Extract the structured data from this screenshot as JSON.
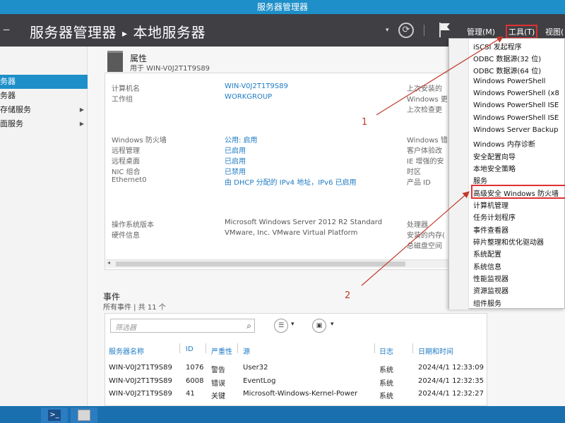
{
  "window": {
    "title": "服务器管理器"
  },
  "header": {
    "breadcrumb_root": "服务器管理器",
    "breadcrumb_sep": "▸",
    "breadcrumb_page": "本地服务器",
    "menu_manage": "管理(M)",
    "menu_tools": "工具(T)",
    "menu_view": "视图("
  },
  "sidebar": {
    "items": [
      {
        "label": "务器",
        "active": true
      },
      {
        "label": "务器",
        "active": false
      },
      {
        "label": "存储服务",
        "active": false
      },
      {
        "label": "面服务",
        "active": false
      }
    ]
  },
  "properties": {
    "title": "属性",
    "subtitle": "用于 WIN-V0J2T1T9S89",
    "rows_left": [
      {
        "label": "计算机名",
        "value": "WIN-V0J2T1T9S89"
      },
      {
        "label": "工作组",
        "value": "WORKGROUP"
      },
      {
        "label": "Windows 防火墙",
        "value": "公用: 启用"
      },
      {
        "label": "远程管理",
        "value": "已启用"
      },
      {
        "label": "远程桌面",
        "value": "已启用"
      },
      {
        "label": "NIC 组合",
        "value": "已禁用"
      },
      {
        "label": "Ethernet0",
        "value": "由 DHCP 分配的 IPv4 地址，IPv6 已启用"
      },
      {
        "label": "操作系统版本",
        "value": "Microsoft Windows Server 2012 R2 Standard"
      },
      {
        "label": "硬件信息",
        "value": "VMware, Inc. VMware Virtual Platform"
      }
    ],
    "rows_right": [
      "上次安装的",
      "Windows 更",
      "上次检查更",
      "Windows 错",
      "客户体验改",
      "IE 增强的安",
      "时区",
      "产品 ID",
      "处理器",
      "安装的内存(",
      "总磁盘空间"
    ]
  },
  "events": {
    "title": "事件",
    "subtitle": "所有事件 | 共 11 个",
    "filter_placeholder": "筛选器",
    "columns": [
      "服务器名称",
      "ID",
      "严重性",
      "源",
      "日志",
      "日期和时间"
    ],
    "rows": [
      [
        "WIN-V0J2T1T9S89",
        "1076",
        "警告",
        "User32",
        "系统",
        "2024/4/1 12:33:09"
      ],
      [
        "WIN-V0J2T1T9S89",
        "6008",
        "错误",
        "EventLog",
        "系统",
        "2024/4/1 12:32:35"
      ],
      [
        "WIN-V0J2T1T9S89",
        "41",
        "关键",
        "Microsoft-Windows-Kernel-Power",
        "系统",
        "2024/4/1 12:32:27"
      ]
    ]
  },
  "tools_menu": {
    "items": [
      "iSCSI 发起程序",
      "ODBC 数据源(32 位)",
      "ODBC 数据源(64 位)",
      "Windows PowerShell",
      "Windows PowerShell (x8",
      "Windows PowerShell ISE",
      "Windows PowerShell ISE",
      "Windows Server Backup",
      "Windows 内存诊断",
      "安全配置向导",
      "本地安全策略",
      "服务",
      "高级安全 Windows 防火墙",
      "计算机管理",
      "任务计划程序",
      "事件查看器",
      "碎片整理和优化驱动器",
      "系统配置",
      "系统信息",
      "性能监视器",
      "资源监视器",
      "组件服务"
    ],
    "highlighted_index": 12
  },
  "annotations": {
    "callout_1": "1",
    "callout_2": "2"
  },
  "colors": {
    "accent": "#1e8fc9",
    "header_bg": "#3f3f44",
    "link": "#1e7bc4",
    "highlight": "#e03030"
  },
  "icons": [
    "back-icon",
    "refresh-icon",
    "flag-icon",
    "search-icon",
    "powershell-icon",
    "server-manager-icon"
  ]
}
